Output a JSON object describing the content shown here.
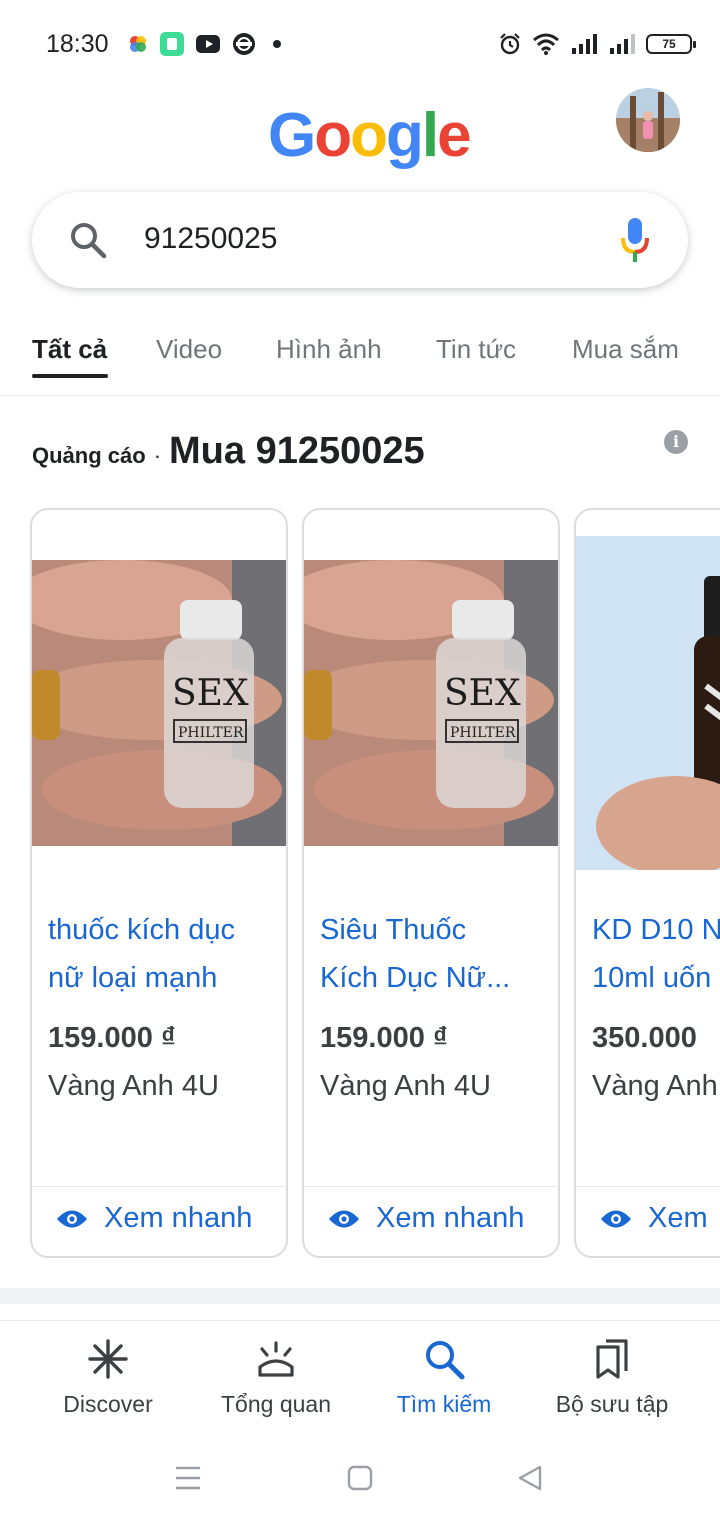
{
  "status_bar": {
    "time": "18:30",
    "battery": "75",
    "icons": [
      "photos-icon",
      "app-icon",
      "youtube-icon",
      "headset-icon",
      "dot-icon",
      "alarm-icon",
      "wifi-icon",
      "signal-icon",
      "signal-icon",
      "battery-icon"
    ]
  },
  "header": {
    "logo_text": "Google",
    "logo_colors": [
      "#4285F4",
      "#EA4335",
      "#FBBC05",
      "#4285F4",
      "#34A853",
      "#EA4335"
    ],
    "avatar": "profile-avatar"
  },
  "search": {
    "query": "91250025",
    "icon": "search-icon",
    "voice_icon": "mic-icon"
  },
  "tabs": [
    {
      "label": "Tất cả",
      "active": true
    },
    {
      "label": "Video",
      "active": false
    },
    {
      "label": "Hình ảnh",
      "active": false
    },
    {
      "label": "Tin tức",
      "active": false
    },
    {
      "label": "Mua sắm",
      "active": false
    }
  ],
  "ads": {
    "label": "Quảng cáo",
    "separator": "·",
    "title": "Mua 91250025",
    "info_icon": "i",
    "products": [
      {
        "name_line1": "thuốc kích dục",
        "name_line2": "nữ loại mạnh",
        "price": "159.000 ₫",
        "seller": "Vàng Anh 4U",
        "action": "Xem nhanh"
      },
      {
        "name_line1": "Siêu Thuốc",
        "name_line2": "Kích Dục Nữ...",
        "price": "159.000 ₫",
        "seller": "Vàng Anh 4U",
        "action": "Xem nhanh"
      },
      {
        "name_line1": "KD D10 N",
        "name_line2": "10ml uốn",
        "price": "350.000",
        "seller": "Vàng Anh",
        "action": "Xem"
      }
    ]
  },
  "bottom_nav": [
    {
      "label": "Discover",
      "icon": "asterisk-icon",
      "active": false
    },
    {
      "label": "Tổng quan",
      "icon": "sunrise-icon",
      "active": false
    },
    {
      "label": "Tìm kiếm",
      "icon": "search-icon",
      "active": true
    },
    {
      "label": "Bộ sưu tập",
      "icon": "bookmarks-icon",
      "active": false
    }
  ],
  "accent_color": "#1967d2"
}
